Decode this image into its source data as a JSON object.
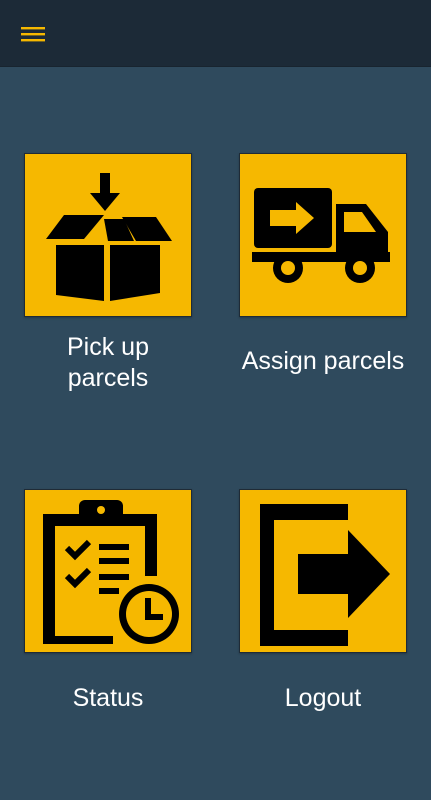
{
  "appbar": {
    "menu_icon": "hamburger-menu-icon",
    "accent_color": "#f6b800"
  },
  "tiles": [
    {
      "label": "Pick up parcels",
      "icon": "box-pickup-icon"
    },
    {
      "label": "Assign parcels",
      "icon": "delivery-truck-icon"
    },
    {
      "label": "Status",
      "icon": "clipboard-clock-icon"
    },
    {
      "label": "Logout",
      "icon": "logout-arrow-icon"
    }
  ],
  "colors": {
    "background": "#2f4a5d",
    "appbar": "#1c2a37",
    "tile": "#f6b800",
    "label": "#ffffff"
  }
}
